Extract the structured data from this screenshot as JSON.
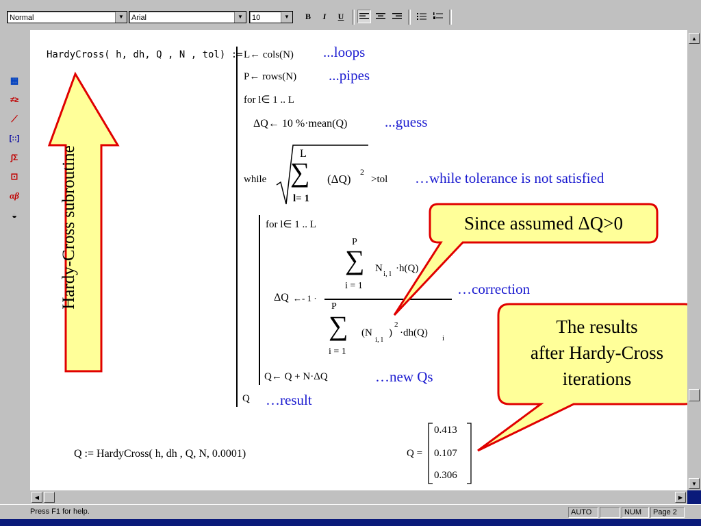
{
  "toolbar": {
    "style_value": "Normal",
    "font_value": "Arial",
    "size_value": "10",
    "bold_label": "B",
    "italic_label": "I",
    "underline_label": "U"
  },
  "palette_icons": [
    "calculator-icon",
    "boolean-icon",
    "graph-icon",
    "matrix-icon",
    "calculus-icon",
    "programming-icon",
    "greek-icon",
    "symbolic-icon"
  ],
  "program": {
    "header": "HardyCross( h, dh, Q , N , tol) :=",
    "line_loops": "L← cols(N)",
    "line_pipes": "P← rows(N)",
    "line_for1": "for  l∈ 1 .. L",
    "line_guess": "ΔQ← 10 %·mean(Q)",
    "while_kw": "while",
    "sum_upper": "L",
    "sum_lower": "l= 1",
    "sum_term": "(ΔQ)",
    "sum_exp": "2",
    "while_cond": ">tol",
    "line_for2": "for  l∈ 1 .. L",
    "dq_assign": "ΔQ",
    "dq_arrow": "←- 1 ·",
    "num_upper": "P",
    "num_lower": "i = 1",
    "num_term": "N",
    "num_sub": "i, l",
    "num_term2": "·h(Q)",
    "num_sub2": "i",
    "den_upper": "P",
    "den_lower": "i = 1",
    "den_term": "(N",
    "den_sub": "i, l",
    "den_exp": "2",
    "den_term2": "·dh(Q)",
    "den_sub2": "i",
    "line_newq": "Q← Q + N·ΔQ",
    "line_result": "Q"
  },
  "comments": {
    "loops": "...loops",
    "pipes": "...pipes",
    "guess": "...guess",
    "while": "…while tolerance is not satisfied",
    "correction": "…correction",
    "newqs": "…new Qs",
    "result": "…result"
  },
  "call_line": "Q := HardyCross( h, dh , Q, N, 0.0001)",
  "result_vector": {
    "label": "Q =",
    "values": [
      "0.413",
      "0.107",
      "0.306"
    ]
  },
  "annotations": {
    "arrow_label": "Hardy-Cross subroutine",
    "callout1": "Since assumed ΔQ>0",
    "callout2_lines": [
      "The results",
      "after Hardy-Cross",
      "iterations"
    ]
  },
  "status": {
    "help_text": "Press F1 for help.",
    "mode": "AUTO",
    "num": "NUM",
    "page": "Page 2"
  },
  "colors": {
    "callout_fill": "#ffff99",
    "callout_border": "#e00000",
    "comment_blue": "#1a1ad0",
    "background_navy": "#0a1a7a"
  }
}
